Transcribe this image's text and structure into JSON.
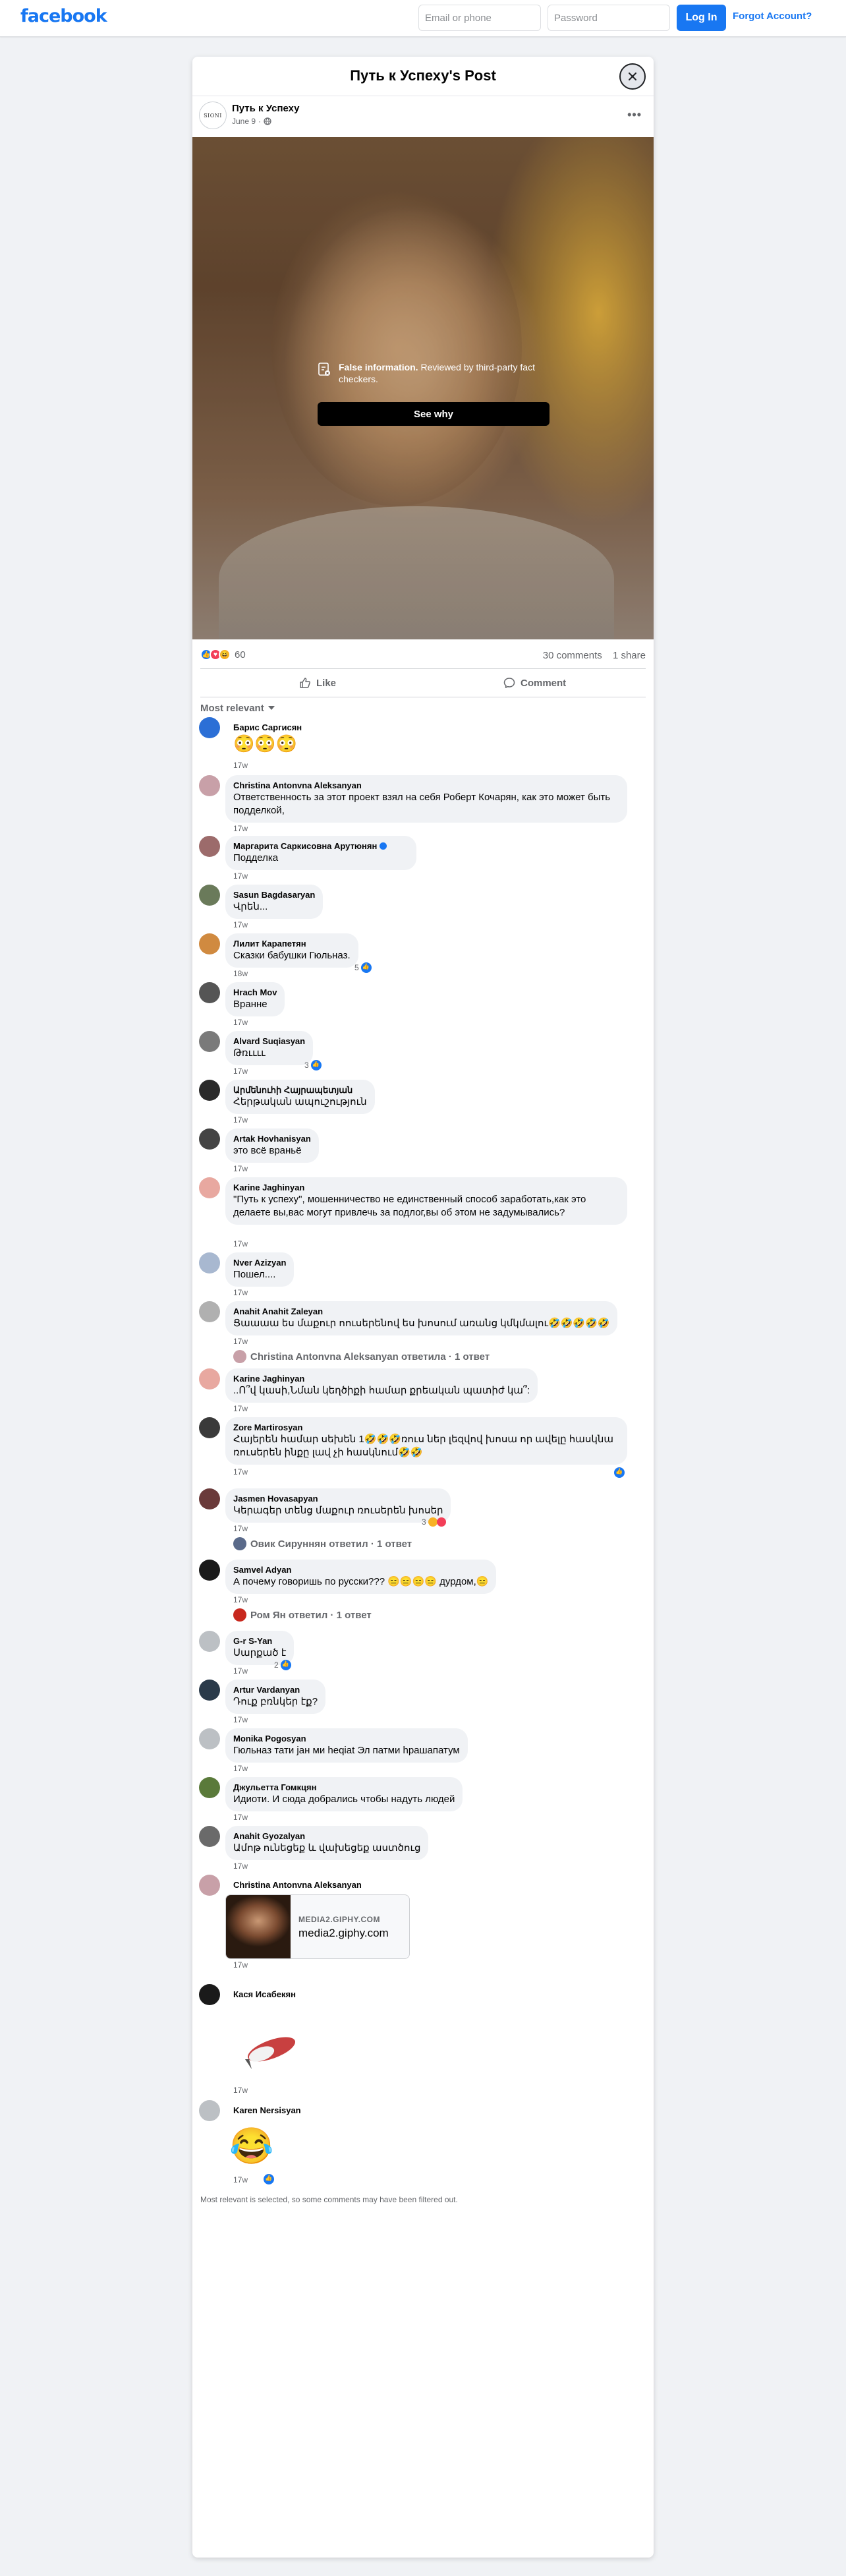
{
  "topbar": {
    "logo": "facebook",
    "email_placeholder": "Email or phone",
    "password_placeholder": "Password",
    "login_label": "Log In",
    "forgot_label": "Forgot Account?"
  },
  "post": {
    "modal_title": "Путь к Успеху's Post",
    "page_name": "Путь к Успеху",
    "avatar_text": "SIONI",
    "date": "June 9",
    "privacy_icon": "globe-icon",
    "warning_title": "False information.",
    "warning_text": " Reviewed by third-party fact checkers.",
    "see_why_label": "See why",
    "reaction_count": "60",
    "comments_count": "30 comments",
    "shares_count": "1 share",
    "like_label": "Like",
    "comment_label": "Comment",
    "sort_label": "Most relevant"
  },
  "comments": [
    {
      "name": "Барис Саргисян",
      "text": "😳😳😳",
      "time": "17w"
    },
    {
      "name": "Christina Antonvna Aleksanyan",
      "text": "Ответственность за этот проект взял на себя Роберт Кочарян, как это может быть подделкой,",
      "time": "17w"
    },
    {
      "name": "Маргарита Саркисовна Арутюнян",
      "text": "Подделка",
      "time": "17w"
    },
    {
      "name": "Sasun Bagdasaryan",
      "text": "Վրեն...",
      "time": "17w"
    },
    {
      "name": "Лилит Карапетян",
      "text": "Сказки бабушки Гюльназ.",
      "time": "18w",
      "likes": "5"
    },
    {
      "name": "Hrach Mov",
      "text": "Вранне",
      "time": "17w"
    },
    {
      "name": "Alvard Suqiasyan",
      "text": "Թռււււ",
      "time": "17w",
      "likes": "3"
    },
    {
      "name": "Արմենուհի Հայրապետյան",
      "text": "Հերթական ապուշություն",
      "time": "17w"
    },
    {
      "name": "Artak Hovhanisyan",
      "text": "это всё враньё",
      "time": "17w"
    },
    {
      "name": "Karine Jaghinyan",
      "text": "\"Путь к успеху\", мошенничество не единственный способ заработать,как это делаете вы,вас могут привлечь за подлог,вы об этом не задумывались?",
      "time": "17w"
    },
    {
      "name": "Nver Azizyan",
      "text": "Пошел....",
      "time": "17w"
    },
    {
      "name": "Anahit Anahit Zaleyan",
      "text": "Ցաաաա ես մաքուր ոուսերենով ես խոսում առանց կմկմալու🤣🤣🤣🤣🤣",
      "time": "17w",
      "reply": "Christina Antonvna Aleksanyan ответила · 1 ответ"
    },
    {
      "name": "Karine Jaghinyan",
      "text": "..Ո՞վ կասի,Նման կեղծիքի համար քրեական պատիժ կա՞:",
      "time": "17w"
    },
    {
      "name": "Zore Martirosyan",
      "text": "Հայերեն համար սեխեն 1🤣🤣🤣ռուս ներ լեզվով խոսա որ ավելը հասկնա ռուսերեն ինքը լավ չի հասկնում🤣🤣",
      "time": "17w"
    },
    {
      "name": "Jasmen Hovasapyan",
      "text": "Կերագեր տենց մաքուր ռուսերեն խոսեր",
      "time": "17w",
      "likes": "3",
      "reply": "Овик Сируннян ответил · 1 ответ"
    },
    {
      "name": "Samvel Adyan",
      "text": "А почему говоришь по русски??? 😑😑😑😑 дурдом,😑",
      "time": "17w",
      "reply": "Ром Ян ответил · 1 ответ"
    },
    {
      "name": "G-r S-Yan",
      "text": "Սարքած է",
      "time": "17w",
      "likes": "2"
    },
    {
      "name": "Artur Vardanyan",
      "text": "Դուք բռնկեր էք?",
      "time": "17w"
    },
    {
      "name": "Monika Pogosyan",
      "text": "Гюльназ тати jан ми heqiat Эл патми hрашапатум",
      "time": "17w"
    },
    {
      "name": "Джульетта Гомкцян",
      "text": "Идиоти. И сюда добрались чтобы надуть людей",
      "time": "17w"
    },
    {
      "name": "Anahit Gyozalyan",
      "text": "Ամոթ ունեցեք և վախեցեք աստծուց",
      "time": "17w"
    },
    {
      "name": "Christina Antonvna Aleksanyan",
      "time": "17w",
      "link_site": "MEDIA2.GIPHY.COM",
      "link_host": "media2.giphy.com"
    },
    {
      "name": "Кася Исабекян",
      "time": "17w"
    },
    {
      "name": "Karen Nersisyan",
      "text": "😂",
      "time": "17w"
    }
  ],
  "footnote": "Most relevant is selected, so some comments may have been filtered out.",
  "colors": {
    "brand": "#1877f2",
    "bubble": "#f0f2f5",
    "muted": "#65676b"
  }
}
